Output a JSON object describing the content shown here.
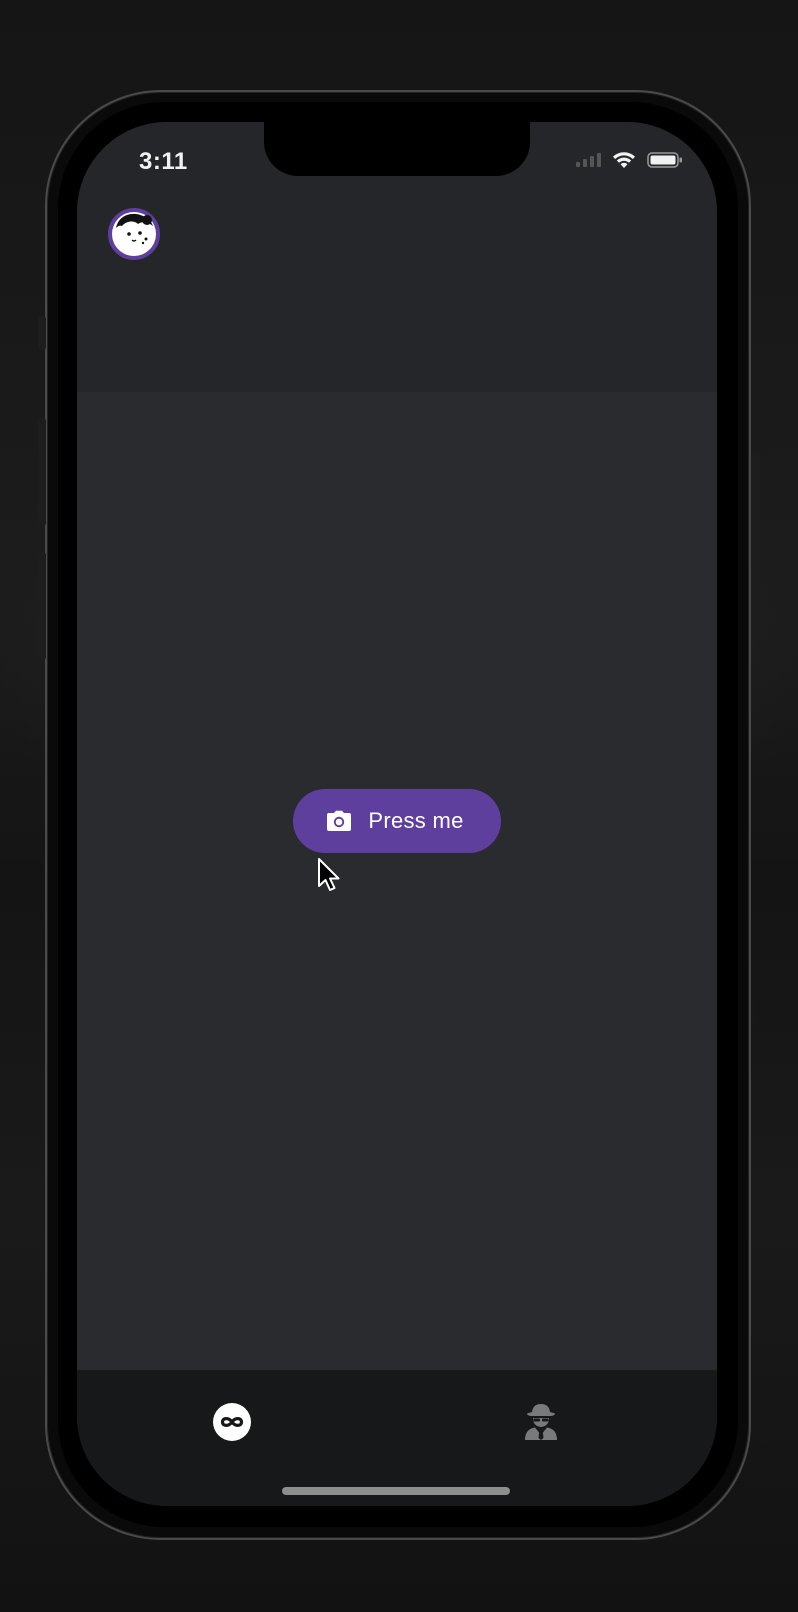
{
  "status_bar": {
    "time": "3:11",
    "wifi_icon": "wifi-icon",
    "battery_icon": "battery-icon",
    "signal_icon": "cellular-signal-icon"
  },
  "header": {
    "avatar_icon": "cartoon-face-avatar"
  },
  "main": {
    "button_label": "Press me",
    "button_icon": "camera-icon"
  },
  "tab_bar": {
    "tabs": [
      {
        "icon": "infinity-icon",
        "active": true
      },
      {
        "icon": "incognito-spy-icon",
        "active": false
      }
    ]
  },
  "colors": {
    "accent": "#5e3f9e",
    "screen_background": "#2a2b2e",
    "header_background": "#252629",
    "tab_bar_background": "#17181a"
  }
}
